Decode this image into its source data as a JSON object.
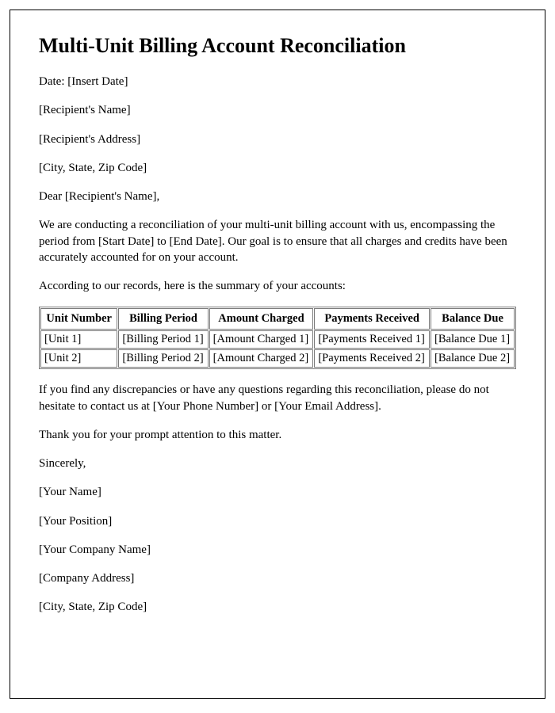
{
  "title": "Multi-Unit Billing Account Reconciliation",
  "date_line": "Date: [Insert Date]",
  "recipient_name": "[Recipient's Name]",
  "recipient_address": "[Recipient's Address]",
  "recipient_city": "[City, State, Zip Code]",
  "salutation": "Dear [Recipient's Name],",
  "body1": "We are conducting a reconciliation of your multi-unit billing account with us, encompassing the period from [Start Date] to [End Date]. Our goal is to ensure that all charges and credits have been accurately accounted for on your account.",
  "body2": "According to our records, here is the summary of your accounts:",
  "table": {
    "headers": {
      "unit": "Unit Number",
      "period": "Billing Period",
      "charged": "Amount Charged",
      "received": "Payments Received",
      "balance": "Balance Due"
    },
    "rows": [
      {
        "unit": "[Unit 1]",
        "period": "[Billing Period 1]",
        "charged": "[Amount Charged 1]",
        "received": "[Payments Received 1]",
        "balance": "[Balance Due 1]"
      },
      {
        "unit": "[Unit 2]",
        "period": "[Billing Period 2]",
        "charged": "[Amount Charged 2]",
        "received": "[Payments Received 2]",
        "balance": "[Balance Due 2]"
      }
    ]
  },
  "body3": "If you find any discrepancies or have any questions regarding this reconciliation, please do not hesitate to contact us at [Your Phone Number] or [Your Email Address].",
  "body4": "Thank you for your prompt attention to this matter.",
  "closing": "Sincerely,",
  "sender_name": "[Your Name]",
  "sender_position": "[Your Position]",
  "sender_company": "[Your Company Name]",
  "company_address": "[Company Address]",
  "company_city": "[City, State, Zip Code]"
}
